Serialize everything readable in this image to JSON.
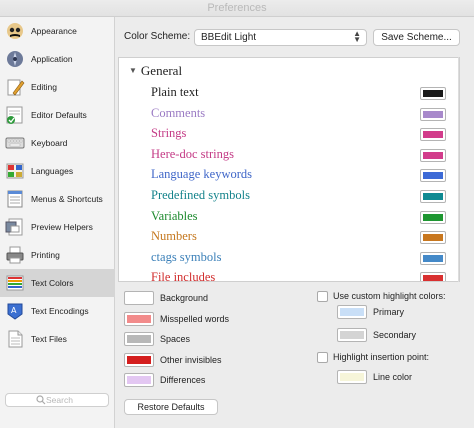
{
  "window": {
    "title": "Preferences"
  },
  "sidebar": {
    "items": [
      {
        "label": "Appearance",
        "icon": "appearance-icon"
      },
      {
        "label": "Application",
        "icon": "application-icon"
      },
      {
        "label": "Editing",
        "icon": "editing-icon"
      },
      {
        "label": "Editor Defaults",
        "icon": "editor-defaults-icon"
      },
      {
        "label": "Keyboard",
        "icon": "keyboard-icon"
      },
      {
        "label": "Languages",
        "icon": "languages-icon"
      },
      {
        "label": "Menus & Shortcuts",
        "icon": "menus-shortcuts-icon"
      },
      {
        "label": "Preview Helpers",
        "icon": "preview-helpers-icon"
      },
      {
        "label": "Printing",
        "icon": "printer-icon"
      },
      {
        "label": "Text Colors",
        "icon": "text-colors-icon",
        "selected": true
      },
      {
        "label": "Text Encodings",
        "icon": "text-encodings-icon"
      },
      {
        "label": "Text Files",
        "icon": "text-files-icon"
      }
    ],
    "search": {
      "placeholder": "Search"
    }
  },
  "scheme": {
    "label": "Color Scheme:",
    "selected": "BBEdit Light",
    "save_button": "Save Scheme..."
  },
  "general": {
    "title": "General",
    "rows": [
      {
        "name": "Plain text",
        "text_color": "#1f1f1f",
        "swatch": "#1a1a1a"
      },
      {
        "name": "Comments",
        "text_color": "#9b7bc4",
        "swatch": "#a889cb"
      },
      {
        "name": "Strings",
        "text_color": "#c43b86",
        "swatch": "#d23c8b"
      },
      {
        "name": "Here-doc strings",
        "text_color": "#c43b86",
        "swatch": "#d23c8b"
      },
      {
        "name": "Language keywords",
        "text_color": "#3f66c8",
        "swatch": "#3d6ad6"
      },
      {
        "name": "Predefined symbols",
        "text_color": "#14838b",
        "swatch": "#0f8a92"
      },
      {
        "name": "Variables",
        "text_color": "#1d8a2e",
        "swatch": "#1e9631"
      },
      {
        "name": "Numbers",
        "text_color": "#c5781f",
        "swatch": "#c8771f"
      },
      {
        "name": "ctags symbols",
        "text_color": "#3a7fb8",
        "swatch": "#4489c8"
      },
      {
        "name": "File includes",
        "text_color": "#d12d2d",
        "swatch": "#d93030"
      }
    ]
  },
  "background_colors": [
    {
      "label": "Background",
      "swatch": "#ffffff"
    },
    {
      "label": "Misspelled words",
      "swatch": "#f28b8b"
    },
    {
      "label": "Spaces",
      "swatch": "#b8b8b8"
    },
    {
      "label": "Other invisibles",
      "swatch": "#d41e1e"
    },
    {
      "label": "Differences",
      "swatch": "#e3c7f2"
    }
  ],
  "highlight": {
    "custom_label": "Use custom highlight colors:",
    "primary_label": "Primary",
    "primary_swatch": "#c9dff7",
    "secondary_label": "Secondary",
    "secondary_swatch": "#d4d4d4",
    "insertion_label": "Highlight insertion point:",
    "line_color_label": "Line color",
    "line_color_swatch": "#f6f5d9"
  },
  "restore_button": "Restore Defaults"
}
